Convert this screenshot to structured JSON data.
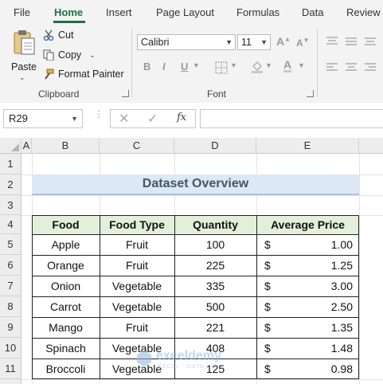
{
  "ribbon": {
    "tabs": [
      {
        "label": "File"
      },
      {
        "label": "Home"
      },
      {
        "label": "Insert"
      },
      {
        "label": "Page Layout"
      },
      {
        "label": "Formulas"
      },
      {
        "label": "Data"
      },
      {
        "label": "Review"
      }
    ],
    "clipboard": {
      "paste_label": "Paste",
      "cut_label": "Cut",
      "copy_label": "Copy",
      "format_painter_label": "Format Painter",
      "group_label": "Clipboard"
    },
    "font": {
      "font_name": "Calibri",
      "font_size": "11",
      "group_label": "Font",
      "bold": "B",
      "italic": "I",
      "underline": "U"
    }
  },
  "formula_bar": {
    "name_box": "R29",
    "fx_label": "fx",
    "formula": ""
  },
  "grid": {
    "columns": [
      "A",
      "B",
      "C",
      "D",
      "E"
    ],
    "rows": [
      "1",
      "2",
      "3",
      "4",
      "5",
      "6",
      "7",
      "8",
      "9",
      "10",
      "11"
    ]
  },
  "sheet": {
    "title": "Dataset Overview",
    "headers": [
      "Food",
      "Food Type",
      "Quantity",
      "Average Price"
    ],
    "currency": "$",
    "rows": [
      {
        "food": "Apple",
        "type": "Fruit",
        "qty": "100",
        "price": "1.00"
      },
      {
        "food": "Orange",
        "type": "Fruit",
        "qty": "225",
        "price": "1.25"
      },
      {
        "food": "Onion",
        "type": "Vegetable",
        "qty": "335",
        "price": "3.00"
      },
      {
        "food": "Carrot",
        "type": "Vegetable",
        "qty": "500",
        "price": "2.50"
      },
      {
        "food": "Mango",
        "type": "Fruit",
        "qty": "221",
        "price": "1.35"
      },
      {
        "food": "Spinach",
        "type": "Vegetable",
        "qty": "408",
        "price": "1.48"
      },
      {
        "food": "Broccoli",
        "type": "Vegetable",
        "qty": "125",
        "price": "0.98"
      }
    ]
  },
  "watermark": {
    "brand": "exceldemy",
    "tagline": "EXCEL · DATA · BI"
  },
  "colors": {
    "accent": "#1f6e43",
    "header_fill": "#e2efda",
    "title_fill": "#dce9f5"
  }
}
